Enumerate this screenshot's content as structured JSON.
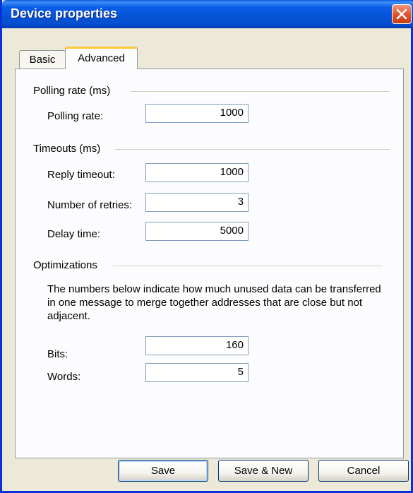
{
  "window": {
    "title": "Device properties"
  },
  "tabs": {
    "basic": "Basic",
    "advanced": "Advanced"
  },
  "polling": {
    "group": "Polling rate (ms)",
    "rate_label": "Polling rate:",
    "rate_value": "1000"
  },
  "timeouts": {
    "group": "Timeouts (ms)",
    "reply_label": "Reply timeout:",
    "reply_value": "1000",
    "retries_label": "Number of retries:",
    "retries_value": "3",
    "delay_label": "Delay time:",
    "delay_value": "5000"
  },
  "optimizations": {
    "group": "Optimizations",
    "description": "The numbers below indicate how much unused data can be transferred in one message to merge together addresses that are close but not adjacent.",
    "bits_label": "Bits:",
    "bits_value": "160",
    "words_label": "Words:",
    "words_value": "5"
  },
  "buttons": {
    "save": "Save",
    "save_new": "Save & New",
    "cancel": "Cancel"
  },
  "icons": {
    "close": "close-icon"
  },
  "colors": {
    "title_bar": "#0553d6",
    "close_button": "#e2552a",
    "active_tab_highlight": "#ffc83c"
  }
}
